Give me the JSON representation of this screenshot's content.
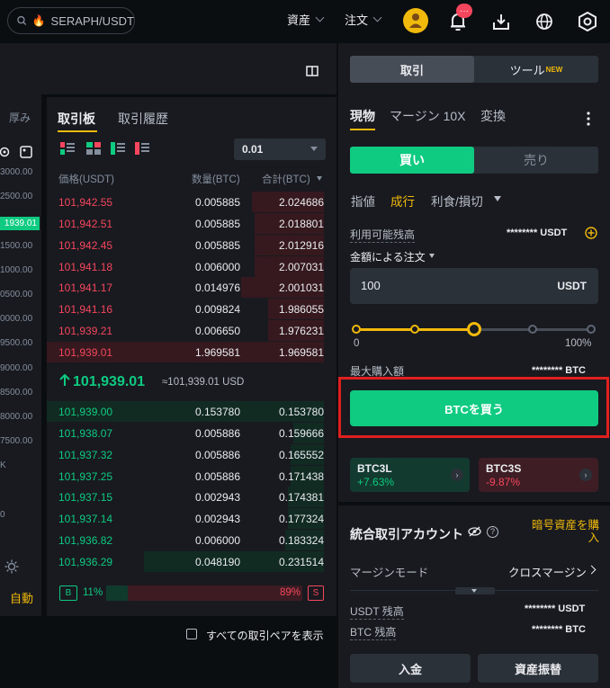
{
  "topbar": {
    "search_placeholder": "SERAPH/USDT",
    "menu_assets": "資産",
    "menu_orders": "注文",
    "notification_badge": "···"
  },
  "chart_area": {
    "depth_label": "厚み",
    "price_ticks": [
      "3000.00",
      "2500.00",
      "",
      "1500.00",
      "1000.00",
      "0500.00",
      "0000.00",
      "9500.00",
      "9000.00",
      "8500.00",
      "8000.00",
      "7500.00",
      "K",
      "",
      "0"
    ],
    "current_price_tag": "1939.01",
    "auto_label": "自動"
  },
  "orderbook": {
    "tab_orderbook": "取引板",
    "tab_history": "取引履歴",
    "precision": "0.01",
    "col_price": "価格(USDT)",
    "col_qty": "数量(BTC)",
    "col_total": "合計(BTC)",
    "asks": [
      {
        "price": "101,942.55",
        "qty": "0.005885",
        "total": "2.024686",
        "depth": 0.26
      },
      {
        "price": "101,942.51",
        "qty": "0.005885",
        "total": "2.018801",
        "depth": 0.25
      },
      {
        "price": "101,942.45",
        "qty": "0.005885",
        "total": "2.012916",
        "depth": 0.25
      },
      {
        "price": "101,941.18",
        "qty": "0.006000",
        "total": "2.007031",
        "depth": 0.25
      },
      {
        "price": "101,941.17",
        "qty": "0.014976",
        "total": "2.001031",
        "depth": 0.3
      },
      {
        "price": "101,941.16",
        "qty": "0.009824",
        "total": "1.986055",
        "depth": 0.2
      },
      {
        "price": "101,939.21",
        "qty": "0.006650",
        "total": "1.976231",
        "depth": 0.2
      },
      {
        "price": "101,939.01",
        "qty": "1.969581",
        "total": "1.969581",
        "depth": 1.0
      }
    ],
    "mid_price": "101,939.01",
    "mid_price_usd": "≈101,939.01 USD",
    "bids": [
      {
        "price": "101,939.00",
        "qty": "0.153780",
        "total": "0.153780",
        "depth": 1.0
      },
      {
        "price": "101,938.07",
        "qty": "0.005886",
        "total": "0.159666",
        "depth": 0.11
      },
      {
        "price": "101,937.32",
        "qty": "0.005886",
        "total": "0.165552",
        "depth": 0.12
      },
      {
        "price": "101,937.25",
        "qty": "0.005886",
        "total": "0.171438",
        "depth": 0.12
      },
      {
        "price": "101,937.15",
        "qty": "0.002943",
        "total": "0.174381",
        "depth": 0.13
      },
      {
        "price": "101,937.14",
        "qty": "0.002943",
        "total": "0.177324",
        "depth": 0.13
      },
      {
        "price": "101,936.82",
        "qty": "0.006000",
        "total": "0.183324",
        "depth": 0.14
      },
      {
        "price": "101,936.29",
        "qty": "0.048190",
        "total": "0.231514",
        "depth": 0.65
      }
    ],
    "buy_ratio_label": "B",
    "buy_ratio": "11%",
    "sell_ratio": "89%",
    "sell_ratio_label": "S",
    "show_all_pairs": "すべての取引ペアを表示"
  },
  "trade_panel": {
    "tab_trade": "取引",
    "tab_tools": "ツール",
    "tools_badge": "NEW",
    "mode_spot": "現物",
    "mode_margin": "マージン 10X",
    "mode_convert": "変換",
    "buy": "買い",
    "sell": "売り",
    "order_limit": "指値",
    "order_market": "成行",
    "order_tpsl": "利食/損切",
    "available_label": "利用可能残高",
    "available_value": "******** USDT",
    "amount_mode": "金額による注文",
    "amount_value": "100",
    "amount_unit": "USDT",
    "slider_min": "0",
    "slider_max": "100%",
    "slider_fraction": 0.5,
    "max_buy_label": "最大購入額",
    "max_buy_value": "******** BTC",
    "buy_button": "BTCを買う",
    "lev_long_name": "BTC3L",
    "lev_long_change": "+7.63%",
    "lev_short_name": "BTC3S",
    "lev_short_change": "-9.87%"
  },
  "account": {
    "title": "統合取引アカウント",
    "buy_crypto": "暗号資産を購入",
    "margin_mode_label": "マージンモード",
    "margin_mode_value": "クロスマージン",
    "usdt_label": "USDT 残高",
    "usdt_value": "******** USDT",
    "btc_label": "BTC 残高",
    "btc_value": "******** BTC",
    "deposit": "入金",
    "transfer": "資産振替"
  },
  "colors": {
    "green": "#0ecb81",
    "red": "#f6465d",
    "accent": "#f0b90b",
    "panel": "#181a20"
  }
}
